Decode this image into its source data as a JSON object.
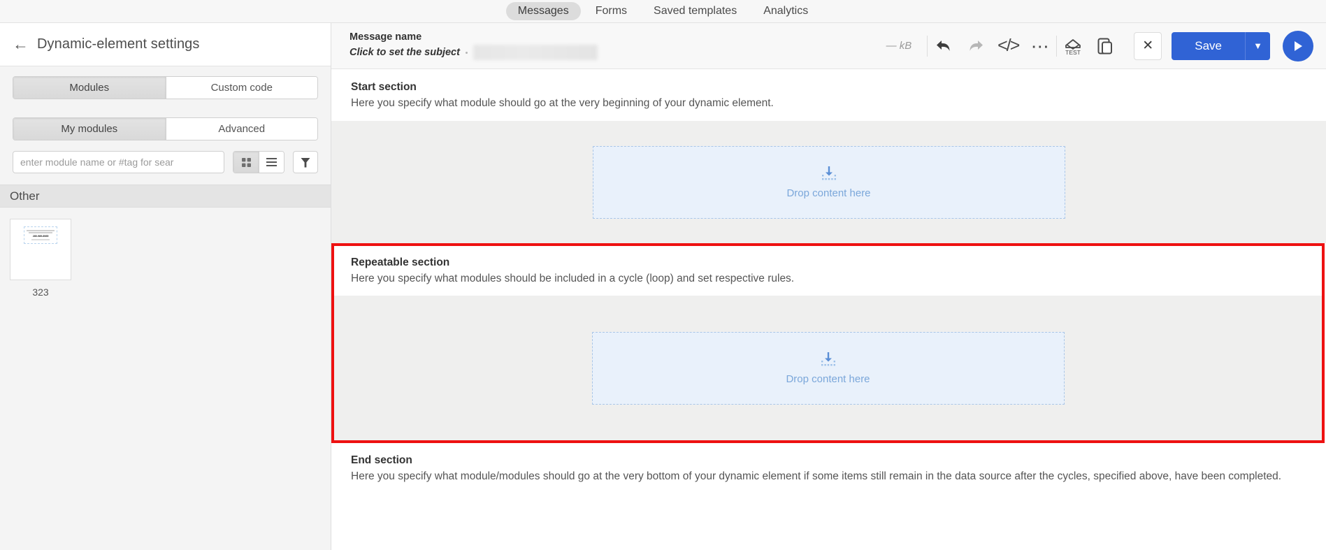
{
  "top_tabs": [
    {
      "label": "Messages",
      "active": true
    },
    {
      "label": "Forms",
      "active": false
    },
    {
      "label": "Saved templates",
      "active": false
    },
    {
      "label": "Analytics",
      "active": false
    }
  ],
  "sidebar": {
    "back_icon": "back-arrow-icon",
    "title": "Dynamic-element settings",
    "primary_segment": [
      {
        "label": "Modules",
        "active": true
      },
      {
        "label": "Custom code",
        "active": false
      }
    ],
    "secondary_segment": [
      {
        "label": "My modules",
        "active": true
      },
      {
        "label": "Advanced",
        "active": false
      }
    ],
    "search": {
      "placeholder": "enter module name or #tag for sear",
      "value": ""
    },
    "view_toggle": [
      {
        "icon": "grid-view-icon",
        "active": true
      },
      {
        "icon": "list-view-icon",
        "active": false
      }
    ],
    "filter_icon": "filter-funnel-icon",
    "group_label": "Other",
    "modules": [
      {
        "name": "323",
        "thumb_text": "280-989-8985"
      }
    ]
  },
  "editor": {
    "message_name": "Message name",
    "subject_prompt": "Click to set the subject",
    "size_label": "— kB",
    "toolbar_icons": [
      {
        "name": "undo-icon",
        "enabled": true
      },
      {
        "name": "redo-icon",
        "enabled": false
      },
      {
        "name": "code-view-icon",
        "enabled": true
      },
      {
        "name": "more-options-icon",
        "enabled": true
      },
      {
        "name": "send-test-icon",
        "enabled": true
      },
      {
        "name": "duplicate-icon",
        "enabled": true
      }
    ],
    "close_label": "✕",
    "save_label": "Save",
    "save_caret_icon": "chevron-down-icon",
    "play_icon": "play-icon"
  },
  "canvas": {
    "start_section": {
      "title": "Start section",
      "description": "Here you specify what module should go at the very beginning of your dynamic element.",
      "dropzone_label": "Drop content here",
      "dropzone_icon": "drop-content-icon"
    },
    "repeatable_section": {
      "title": "Repeatable section",
      "description": "Here you specify what modules should be included in a cycle (loop) and set respective rules.",
      "dropzone_label": "Drop content here",
      "dropzone_icon": "drop-content-icon",
      "highlight_color": "#ee1111"
    },
    "end_section": {
      "title": "End section",
      "description": "Here you specify what module/modules should go at the very bottom of your dynamic element if some items still remain in the data source after the cycles, specified above, have been completed."
    }
  },
  "colors": {
    "accent": "#3063d5",
    "highlight": "#ee1111",
    "dropzone_bg": "#e9f1fb",
    "dropzone_border": "#a9c6e8",
    "canvas_gray": "#efefee"
  }
}
